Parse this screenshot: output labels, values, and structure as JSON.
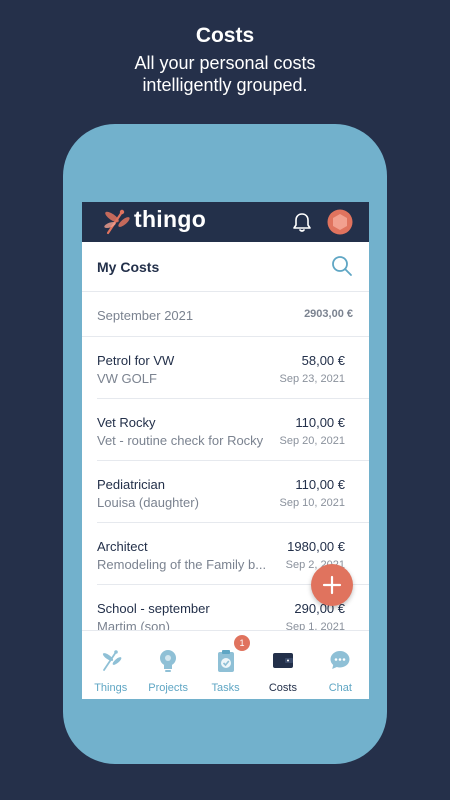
{
  "promo": {
    "title": "Costs",
    "subtitle_line1": "All your personal costs",
    "subtitle_line2": "intelligently grouped."
  },
  "app": {
    "brand": "thingo",
    "header_title": "My Costs"
  },
  "section": {
    "month": "September 2021",
    "total": "2903,00 €"
  },
  "costs": [
    {
      "title": "Petrol for VW",
      "subtitle": "VW GOLF",
      "amount": "58,00 €",
      "date": "Sep 23, 2021"
    },
    {
      "title": "Vet Rocky",
      "subtitle": "Vet - routine check for Rocky",
      "amount": "110,00 €",
      "date": "Sep 20, 2021"
    },
    {
      "title": "Pediatrician",
      "subtitle": "Louisa (daughter)",
      "amount": "110,00 €",
      "date": "Sep 10, 2021"
    },
    {
      "title": "Architect",
      "subtitle": "Remodeling of the Family b...",
      "amount": "1980,00 €",
      "date": "Sep 2, 2021"
    },
    {
      "title": "School - september",
      "subtitle": "Martim (son)",
      "amount": "290,00 €",
      "date": "Sep 1, 2021"
    }
  ],
  "nav": [
    {
      "label": "Things",
      "icon": "dragonfly-icon"
    },
    {
      "label": "Projects",
      "icon": "lightbulb-icon"
    },
    {
      "label": "Tasks",
      "icon": "clipboard-check-icon",
      "badge": "1"
    },
    {
      "label": "Costs",
      "icon": "wallet-icon",
      "active": true
    },
    {
      "label": "Chat",
      "icon": "chat-bubble-icon"
    }
  ],
  "colors": {
    "background": "#25304a",
    "phone_frame": "#72b1cc",
    "accent": "#e0735e",
    "link": "#5fa6c4"
  }
}
